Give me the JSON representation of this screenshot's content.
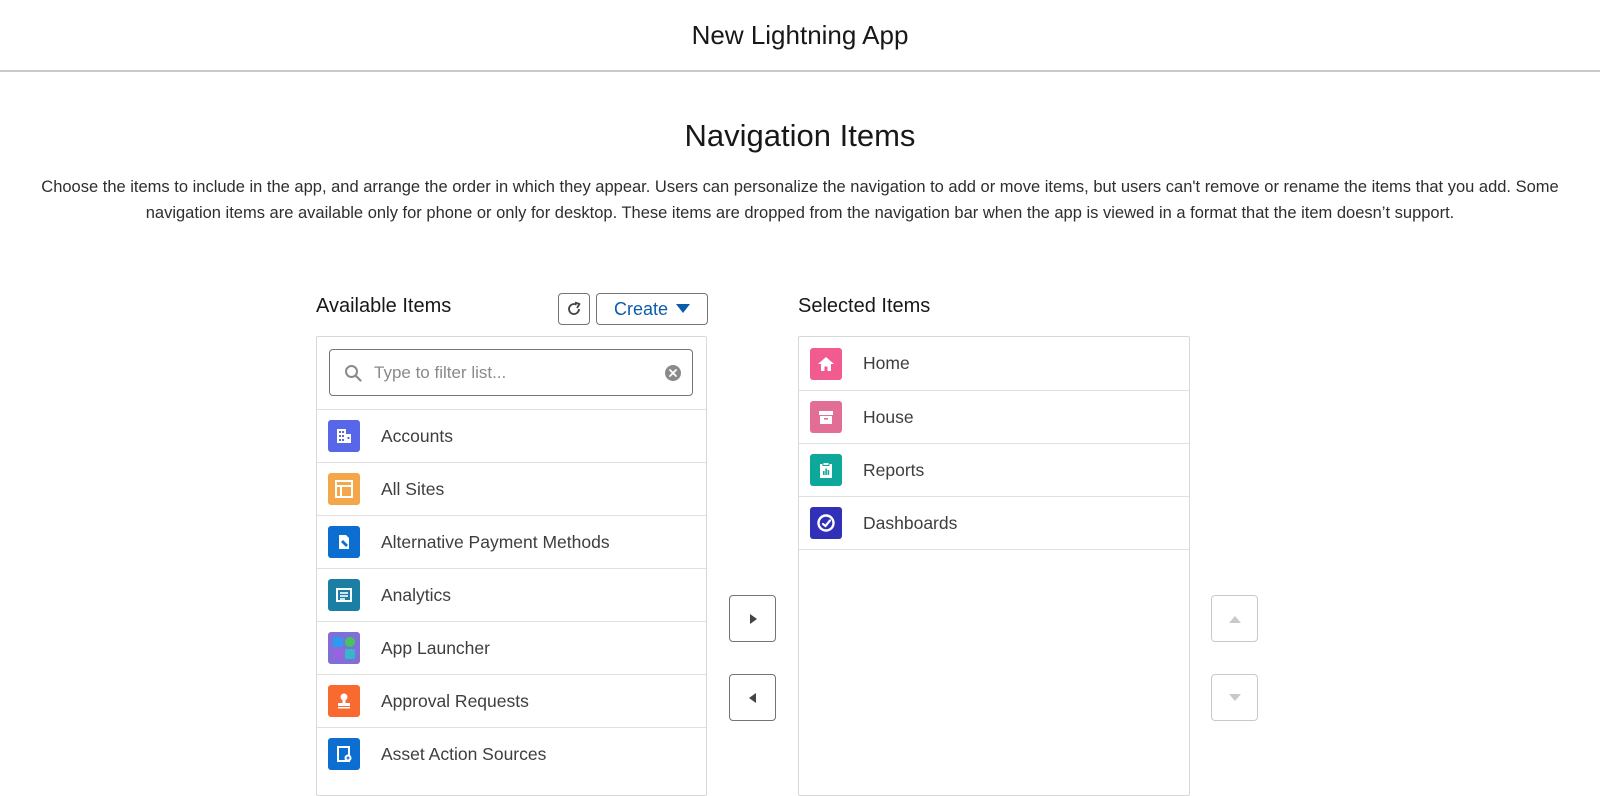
{
  "header": {
    "title": "New Lightning App"
  },
  "section": {
    "title": "Navigation Items",
    "description": "Choose the items to include in the app, and arrange the order in which they appear. Users can personalize the navigation to add or move items, but users can't remove or rename the items that you add. Some navigation items are available only for phone or only for desktop. These items are dropped from the navigation bar when the app is viewed in a format that the item doesn’t support."
  },
  "available": {
    "label": "Available Items",
    "create_label": "Create",
    "search_placeholder": "Type to filter list...",
    "items": [
      {
        "label": "Accounts",
        "icon": "accounts-icon",
        "color": "#5867e8"
      },
      {
        "label": "All Sites",
        "icon": "sites-icon",
        "color": "#f4a64a"
      },
      {
        "label": "Alternative Payment Methods",
        "icon": "payment-icon",
        "color": "#0b6ed0"
      },
      {
        "label": "Analytics",
        "icon": "analytics-icon",
        "color": "#1b7fa3"
      },
      {
        "label": "App Launcher",
        "icon": "app-launcher-icon",
        "color": "#7f6fd8"
      },
      {
        "label": "Approval Requests",
        "icon": "approval-icon",
        "color": "#f96a31"
      },
      {
        "label": "Asset Action Sources",
        "icon": "asset-action-icon",
        "color": "#0b6ed0"
      }
    ]
  },
  "selected": {
    "label": "Selected Items",
    "items": [
      {
        "label": "Home",
        "icon": "home-icon",
        "color": "#f25b8f"
      },
      {
        "label": "House",
        "icon": "house-icon",
        "color": "#e36e95"
      },
      {
        "label": "Reports",
        "icon": "reports-icon",
        "color": "#0ea89a"
      },
      {
        "label": "Dashboards",
        "icon": "dashboards-icon",
        "color": "#3131b8"
      }
    ]
  }
}
